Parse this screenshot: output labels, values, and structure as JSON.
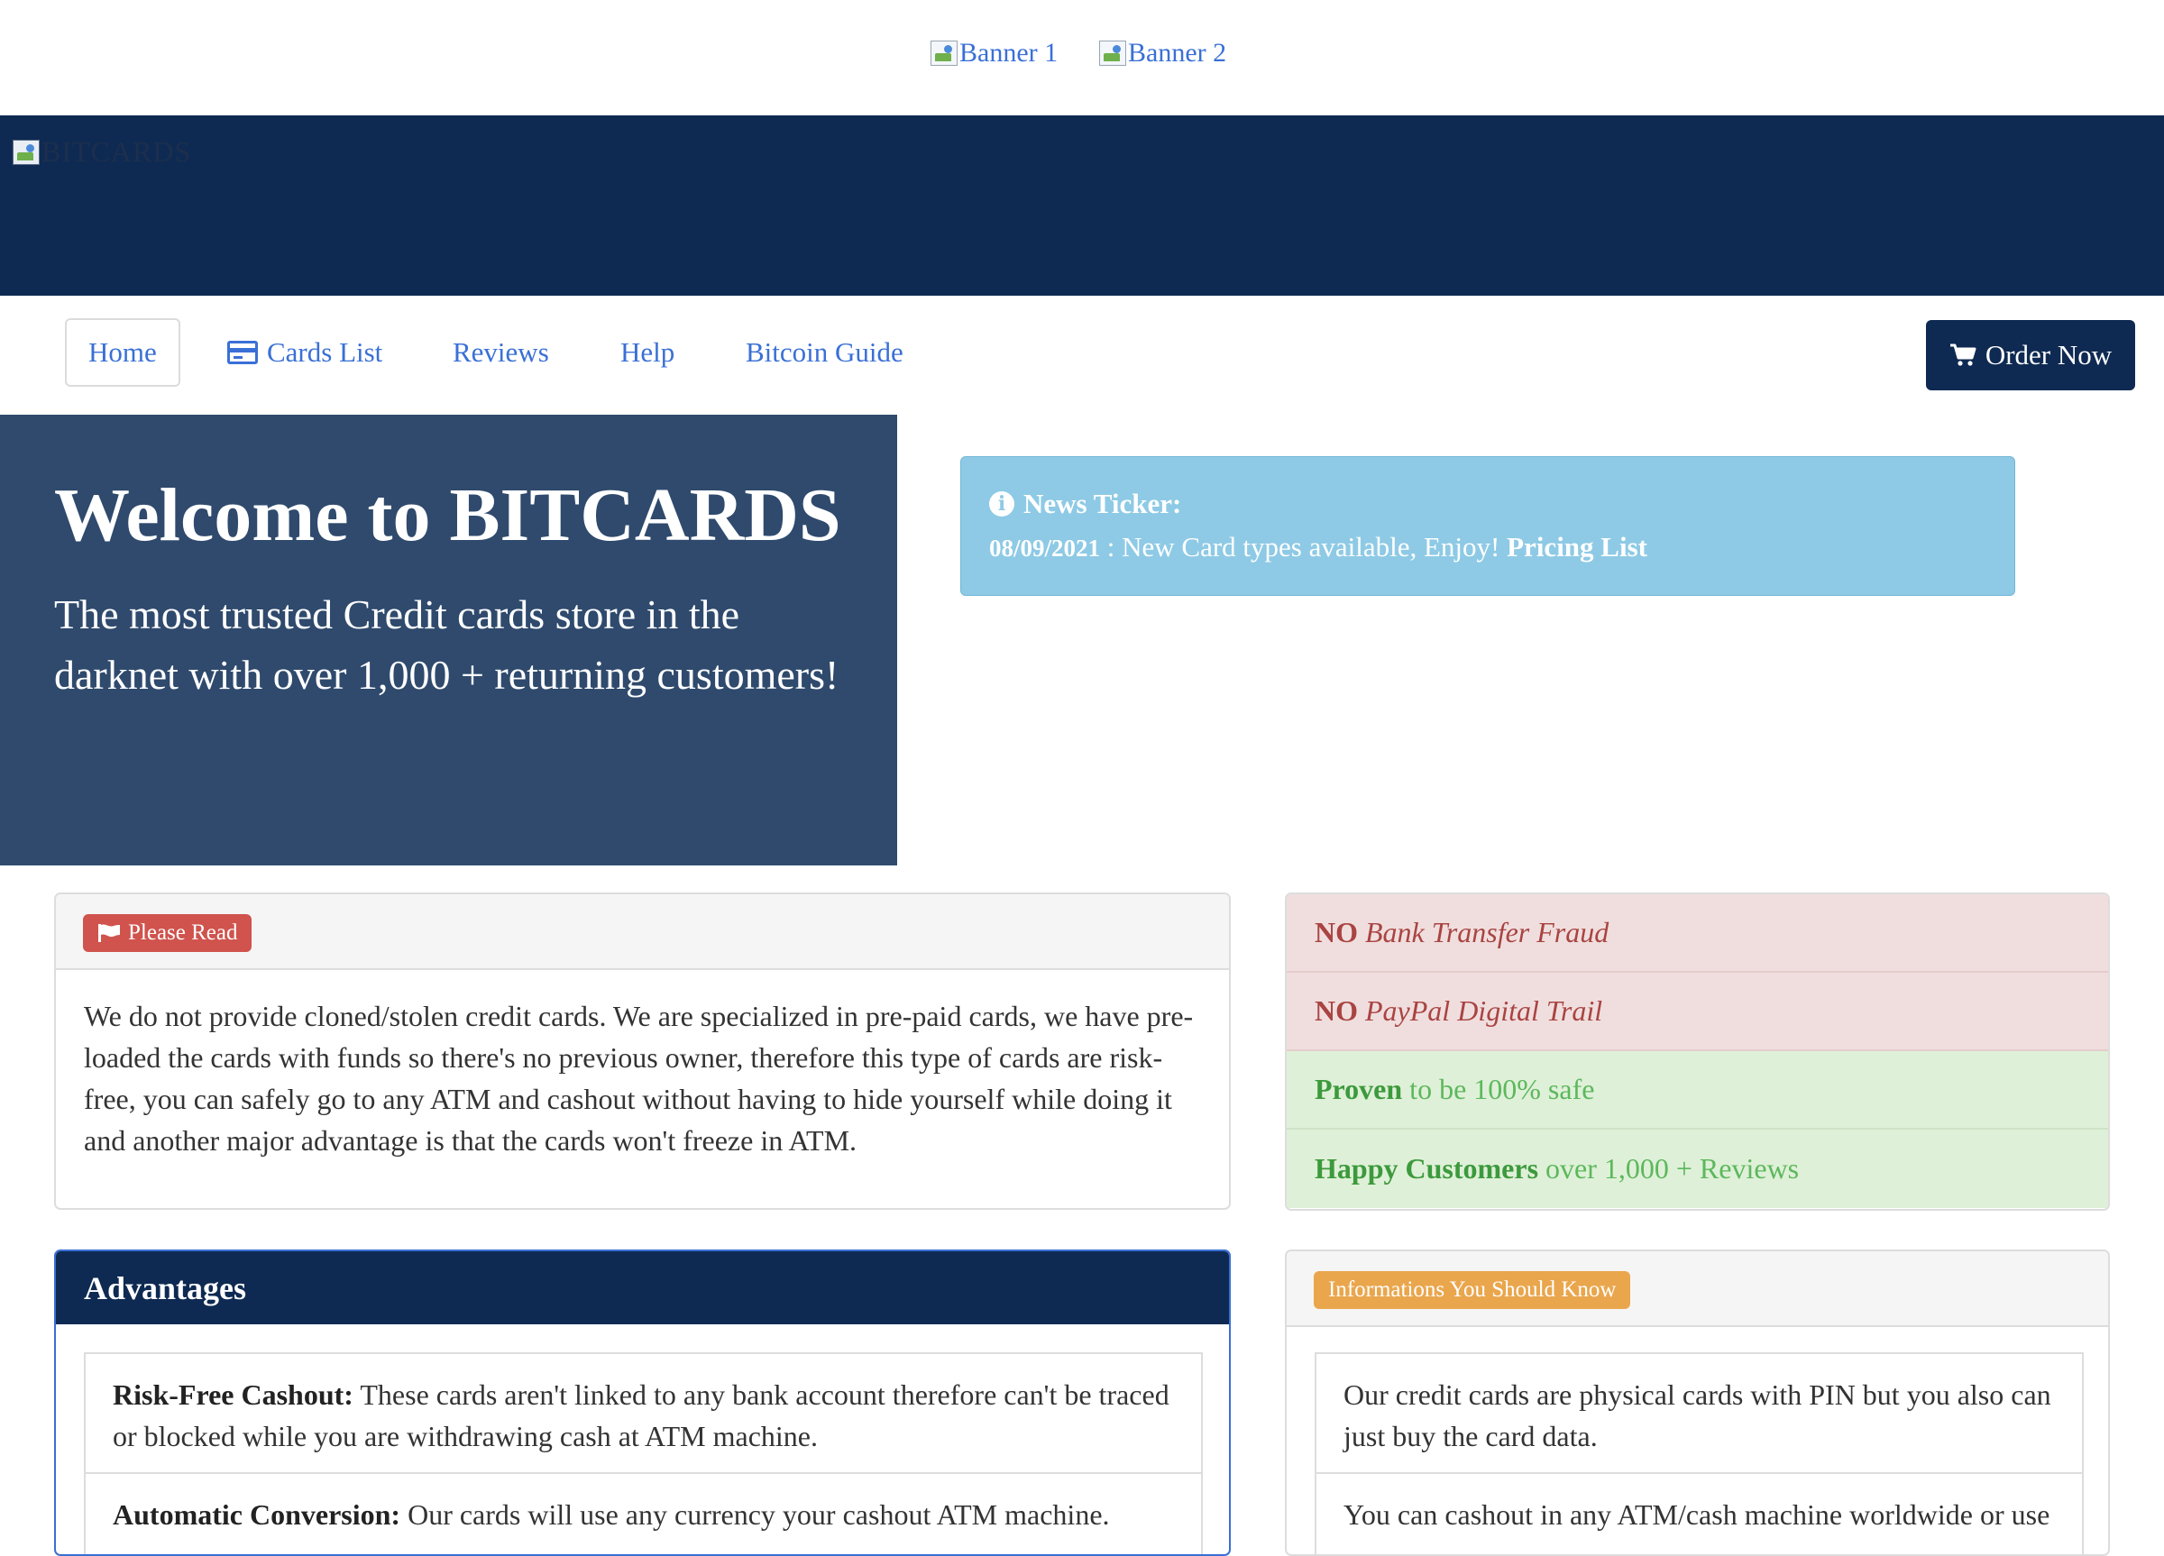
{
  "banners": {
    "banner1_alt": "Banner 1",
    "banner2_alt": "Banner 2"
  },
  "header": {
    "logo_alt": "BITCARDS"
  },
  "nav": {
    "home": "Home",
    "cards_list": "Cards List",
    "reviews": "Reviews",
    "help": "Help",
    "bitcoin_guide": "Bitcoin Guide",
    "order_now": "Order Now"
  },
  "hero": {
    "title": "Welcome to BITCARDS",
    "subtitle": "The most trusted Credit cards store in the darknet with over 1,000 + returning customers!"
  },
  "news": {
    "title": "News Ticker:",
    "date": "08/09/2021",
    "separator": " : ",
    "message": "New Card types available, Enjoy! ",
    "link": "Pricing List"
  },
  "please_read": {
    "label": "Please Read",
    "body": "We do not provide cloned/stolen credit cards. We are specialized in pre-paid cards, we have pre-loaded the cards with funds so there's no previous owner, therefore this type of cards are risk-free, you can safely go to any ATM and cashout without having to hide yourself while doing it and another major advantage is that the cards won't freeze in ATM."
  },
  "features": [
    {
      "strong": "NO",
      "text": "Bank Transfer Fraud"
    },
    {
      "strong": "NO",
      "text": "PayPal Digital Trail"
    },
    {
      "strong": "Proven",
      "text": "to be 100% safe"
    },
    {
      "strong": "Happy Customers",
      "text": "over 1,000 + Reviews"
    }
  ],
  "advantages": {
    "title": "Advantages",
    "items": [
      {
        "title": "Risk-Free Cashout:",
        "text": "These cards aren't linked to any bank account therefore can't be traced or blocked while you are withdrawing cash at ATM machine."
      },
      {
        "title": "Automatic Conversion:",
        "text": "Our cards will use any currency your cashout ATM machine."
      }
    ]
  },
  "info": {
    "label": "Informations You Should Know",
    "items": [
      "Our credit cards are physical cards with PIN but you also can just buy the card data.",
      "You can cashout in any ATM/cash machine worldwide or use"
    ]
  },
  "colors": {
    "navy": "#0e2a52",
    "hero": "#2f4a6d",
    "link": "#3a70d6",
    "news": "#8ecae5",
    "danger": "#d0534d",
    "warning": "#eaa64c"
  }
}
